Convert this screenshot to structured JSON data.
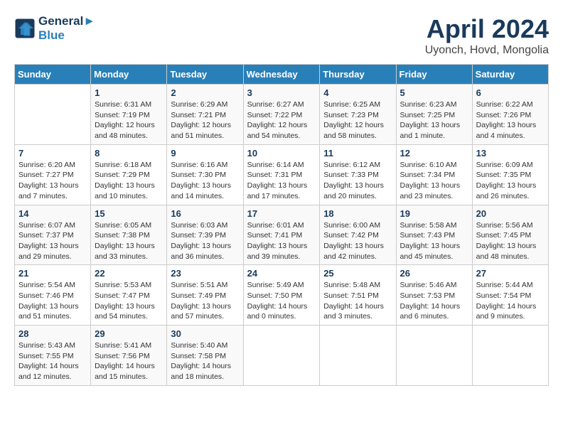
{
  "header": {
    "logo_line1": "General",
    "logo_line2": "Blue",
    "title": "April 2024",
    "location": "Uyonch, Hovd, Mongolia"
  },
  "weekdays": [
    "Sunday",
    "Monday",
    "Tuesday",
    "Wednesday",
    "Thursday",
    "Friday",
    "Saturday"
  ],
  "weeks": [
    [
      {
        "day": "",
        "info": ""
      },
      {
        "day": "1",
        "info": "Sunrise: 6:31 AM\nSunset: 7:19 PM\nDaylight: 12 hours\nand 48 minutes."
      },
      {
        "day": "2",
        "info": "Sunrise: 6:29 AM\nSunset: 7:21 PM\nDaylight: 12 hours\nand 51 minutes."
      },
      {
        "day": "3",
        "info": "Sunrise: 6:27 AM\nSunset: 7:22 PM\nDaylight: 12 hours\nand 54 minutes."
      },
      {
        "day": "4",
        "info": "Sunrise: 6:25 AM\nSunset: 7:23 PM\nDaylight: 12 hours\nand 58 minutes."
      },
      {
        "day": "5",
        "info": "Sunrise: 6:23 AM\nSunset: 7:25 PM\nDaylight: 13 hours\nand 1 minute."
      },
      {
        "day": "6",
        "info": "Sunrise: 6:22 AM\nSunset: 7:26 PM\nDaylight: 13 hours\nand 4 minutes."
      }
    ],
    [
      {
        "day": "7",
        "info": "Sunrise: 6:20 AM\nSunset: 7:27 PM\nDaylight: 13 hours\nand 7 minutes."
      },
      {
        "day": "8",
        "info": "Sunrise: 6:18 AM\nSunset: 7:29 PM\nDaylight: 13 hours\nand 10 minutes."
      },
      {
        "day": "9",
        "info": "Sunrise: 6:16 AM\nSunset: 7:30 PM\nDaylight: 13 hours\nand 14 minutes."
      },
      {
        "day": "10",
        "info": "Sunrise: 6:14 AM\nSunset: 7:31 PM\nDaylight: 13 hours\nand 17 minutes."
      },
      {
        "day": "11",
        "info": "Sunrise: 6:12 AM\nSunset: 7:33 PM\nDaylight: 13 hours\nand 20 minutes."
      },
      {
        "day": "12",
        "info": "Sunrise: 6:10 AM\nSunset: 7:34 PM\nDaylight: 13 hours\nand 23 minutes."
      },
      {
        "day": "13",
        "info": "Sunrise: 6:09 AM\nSunset: 7:35 PM\nDaylight: 13 hours\nand 26 minutes."
      }
    ],
    [
      {
        "day": "14",
        "info": "Sunrise: 6:07 AM\nSunset: 7:37 PM\nDaylight: 13 hours\nand 29 minutes."
      },
      {
        "day": "15",
        "info": "Sunrise: 6:05 AM\nSunset: 7:38 PM\nDaylight: 13 hours\nand 33 minutes."
      },
      {
        "day": "16",
        "info": "Sunrise: 6:03 AM\nSunset: 7:39 PM\nDaylight: 13 hours\nand 36 minutes."
      },
      {
        "day": "17",
        "info": "Sunrise: 6:01 AM\nSunset: 7:41 PM\nDaylight: 13 hours\nand 39 minutes."
      },
      {
        "day": "18",
        "info": "Sunrise: 6:00 AM\nSunset: 7:42 PM\nDaylight: 13 hours\nand 42 minutes."
      },
      {
        "day": "19",
        "info": "Sunrise: 5:58 AM\nSunset: 7:43 PM\nDaylight: 13 hours\nand 45 minutes."
      },
      {
        "day": "20",
        "info": "Sunrise: 5:56 AM\nSunset: 7:45 PM\nDaylight: 13 hours\nand 48 minutes."
      }
    ],
    [
      {
        "day": "21",
        "info": "Sunrise: 5:54 AM\nSunset: 7:46 PM\nDaylight: 13 hours\nand 51 minutes."
      },
      {
        "day": "22",
        "info": "Sunrise: 5:53 AM\nSunset: 7:47 PM\nDaylight: 13 hours\nand 54 minutes."
      },
      {
        "day": "23",
        "info": "Sunrise: 5:51 AM\nSunset: 7:49 PM\nDaylight: 13 hours\nand 57 minutes."
      },
      {
        "day": "24",
        "info": "Sunrise: 5:49 AM\nSunset: 7:50 PM\nDaylight: 14 hours\nand 0 minutes."
      },
      {
        "day": "25",
        "info": "Sunrise: 5:48 AM\nSunset: 7:51 PM\nDaylight: 14 hours\nand 3 minutes."
      },
      {
        "day": "26",
        "info": "Sunrise: 5:46 AM\nSunset: 7:53 PM\nDaylight: 14 hours\nand 6 minutes."
      },
      {
        "day": "27",
        "info": "Sunrise: 5:44 AM\nSunset: 7:54 PM\nDaylight: 14 hours\nand 9 minutes."
      }
    ],
    [
      {
        "day": "28",
        "info": "Sunrise: 5:43 AM\nSunset: 7:55 PM\nDaylight: 14 hours\nand 12 minutes."
      },
      {
        "day": "29",
        "info": "Sunrise: 5:41 AM\nSunset: 7:56 PM\nDaylight: 14 hours\nand 15 minutes."
      },
      {
        "day": "30",
        "info": "Sunrise: 5:40 AM\nSunset: 7:58 PM\nDaylight: 14 hours\nand 18 minutes."
      },
      {
        "day": "",
        "info": ""
      },
      {
        "day": "",
        "info": ""
      },
      {
        "day": "",
        "info": ""
      },
      {
        "day": "",
        "info": ""
      }
    ]
  ]
}
